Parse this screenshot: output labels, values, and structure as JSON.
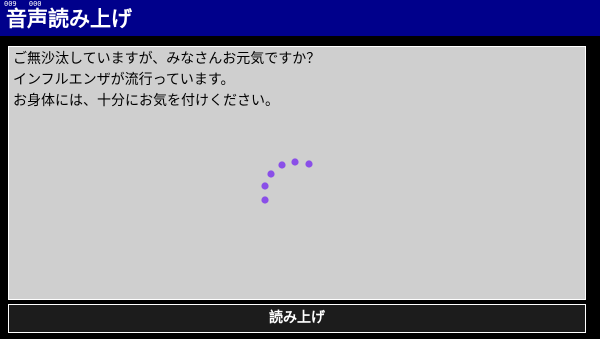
{
  "header": {
    "counters": [
      "009",
      "000"
    ],
    "title": "音声読み上げ",
    "background_color": "#00008b"
  },
  "main": {
    "message_lines": [
      "ご無沙汰していますが、みなさんお元気ですか？",
      "インフルエンザが流行っています。",
      "お身体には、十分にお気を付けください。"
    ],
    "panel_color": "#cfcfcf",
    "loading_indicator": {
      "icon": "loading-spinner-icon",
      "dot_color": "#8a4fe8"
    }
  },
  "footer": {
    "read_button_label": "読み上げ"
  }
}
